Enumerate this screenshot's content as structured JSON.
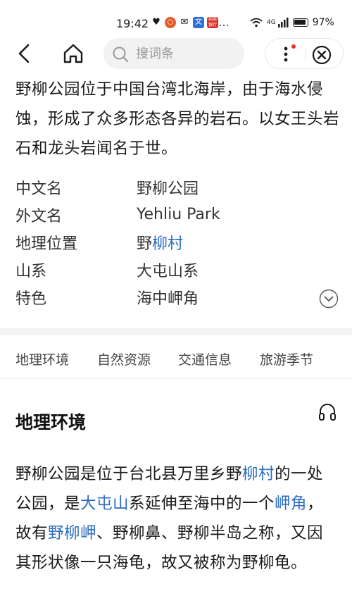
{
  "status_bar": {
    "time": "19:42",
    "network": "4G",
    "battery": "97%",
    "badge_red_text": "招商\n银行",
    "badge_blue_text": "文"
  },
  "nav": {
    "search_placeholder": "搜词条"
  },
  "article": {
    "intro": "野柳公园位于中国台湾北海岸，由于海水侵蚀，形成了众多形态各异的岩石。以女王头岩石和龙头岩闻名于世。",
    "infobox": [
      {
        "label": "中文名",
        "value": "野柳公园"
      },
      {
        "label": "外文名",
        "value": "Yehliu Park"
      },
      {
        "label": "地理位置",
        "value_plain": "野",
        "value_link": "柳村"
      },
      {
        "label": "山系",
        "value": "大屯山系"
      },
      {
        "label": "特色",
        "value": "海中岬角"
      }
    ],
    "tabs": [
      "地理环境",
      "自然资源",
      "交通信息",
      "旅游季节"
    ],
    "section_title": "地理环境",
    "section_body": {
      "p1": "野柳公园是位于台北县万里乡野",
      "link1": "柳村",
      "p2": "的一处公园，是",
      "link2": "大屯山",
      "p3": "系延伸至海中的一个",
      "link3": "岬角",
      "p4": "，故有",
      "link4": "野柳岬",
      "p5": "、野柳鼻、野柳半岛之称，又因其形状像一只海龟，故又被称为野柳龟。"
    }
  },
  "colors": {
    "link": "#2b6cc4",
    "notification_dot": "#e5332a"
  }
}
